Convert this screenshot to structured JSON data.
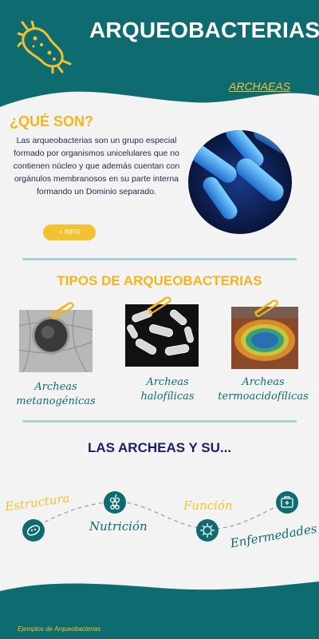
{
  "header": {
    "title": "ARQUEOBACTERIAS",
    "subtitle": "ARCHAEAS"
  },
  "que_son": {
    "title": "¿QUÉ SON?",
    "text": "Las arqueobacterias son un grupo especial formado por organismos unicelulares que no contienen núcleo y que además cuentan con orgánulos membranosos en su parte interna formando un Dominio separado.",
    "button": "+ INFO"
  },
  "tipos": {
    "title": "TIPOS DE ARQUEOBACTERIAS",
    "items": [
      {
        "label_1": "Archeas",
        "label_2": "metanogénicas"
      },
      {
        "label_1": "Archeas",
        "label_2": "halofílicas"
      },
      {
        "label_1": "Archeas",
        "label_2": "termoacidofílicas"
      }
    ]
  },
  "archeas": {
    "title": "LAS ARCHEAS Y SU...",
    "labels": {
      "estructura": "Estructura",
      "nutricion": "Nutrición",
      "funcion": "Función",
      "enfermedades": "Enfermedades"
    }
  },
  "footer": {
    "note": "Ejemplos de Arqueobacterias"
  },
  "colors": {
    "teal": "#0e6c70",
    "yellow": "#f2c230",
    "navy": "#1b1f6b",
    "divider": "#a9d3d4"
  }
}
